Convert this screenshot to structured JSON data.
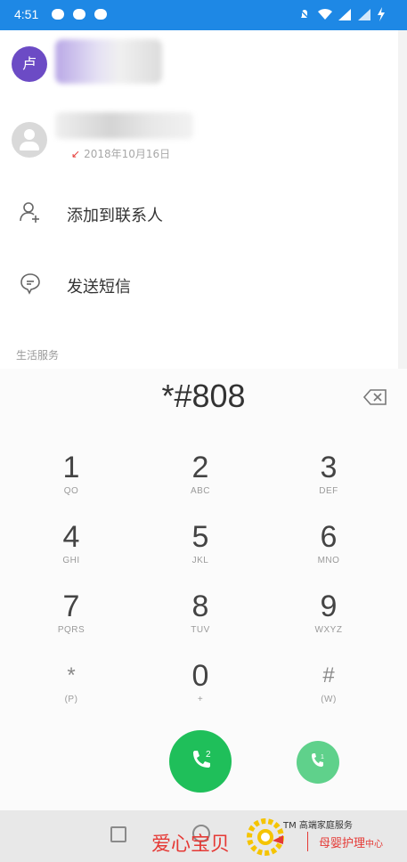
{
  "status_bar": {
    "time": "4:51"
  },
  "contacts": {
    "avatar_letter": "卢",
    "recent_call_date": "2018年10月16日"
  },
  "actions": {
    "add_contact": "添加到联系人",
    "send_sms": "发送短信"
  },
  "section_title": "生活服务",
  "dialer": {
    "input": "*#808",
    "keys": [
      {
        "num": "1",
        "sub": "QO"
      },
      {
        "num": "2",
        "sub": "ABC"
      },
      {
        "num": "3",
        "sub": "DEF"
      },
      {
        "num": "4",
        "sub": "GHI"
      },
      {
        "num": "5",
        "sub": "JKL"
      },
      {
        "num": "6",
        "sub": "MNO"
      },
      {
        "num": "7",
        "sub": "PQRS"
      },
      {
        "num": "8",
        "sub": "TUV"
      },
      {
        "num": "9",
        "sub": "WXYZ"
      },
      {
        "num": "*",
        "sub": "(P)"
      },
      {
        "num": "0",
        "sub": "+"
      },
      {
        "num": "#",
        "sub": "(W)"
      }
    ],
    "sim_labels": {
      "main": "2",
      "secondary": "1"
    }
  },
  "watermark": {
    "brand": "爱心宝贝",
    "tm": "TM 高端家庭服务",
    "sub": "母婴护理",
    "sub_small": "中心"
  },
  "colors": {
    "status_bar": "#1e88e5",
    "call_green": "#1fbf5a",
    "avatar_purple": "#6c4bc5"
  }
}
